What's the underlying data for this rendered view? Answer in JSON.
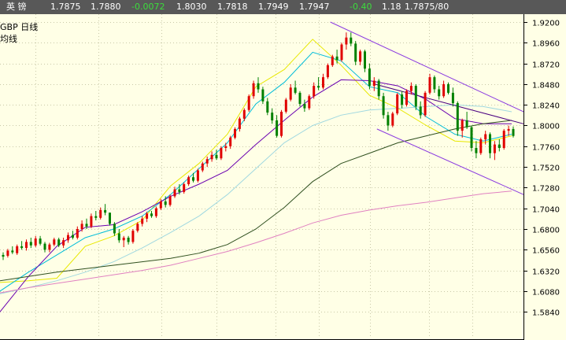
{
  "quote_bar": {
    "name": "英   镑",
    "last": "1.7875",
    "ask": "1.7880",
    "change": "-0.0072",
    "open": "1.8030",
    "low": "1.7818",
    "high": "1.7949",
    "close": "1.7947",
    "pct_change": "-0.40",
    "ratio": "1.18",
    "bid_ask": "1.7875/80"
  },
  "chart_labels": {
    "symbol_line1": "GBP  日线",
    "symbol_line2": "均线"
  },
  "colors": {
    "background": "#ffffe6",
    "up_candle": "#e00000",
    "down_candle": "#008000",
    "ma_fast": "#e8e800",
    "ma_cyan": "#00bcd8",
    "ma_purple": "#6a00b0",
    "ma_lightblue": "#a0d8e0",
    "ma_darkgreen": "#305020",
    "ma_pink": "#e080c0",
    "channel": "#8a3ae0",
    "axis_panel": "#ffffe6"
  },
  "chart_data": {
    "type": "candlestick",
    "title": "",
    "ylim": [
      1.57,
      1.935
    ],
    "y_ticks": [
      "1.9200",
      "1.8960",
      "1.8720",
      "1.8480",
      "1.8240",
      "1.8000",
      "1.7760",
      "1.7520",
      "1.7280",
      "1.7040",
      "1.6800",
      "1.6560",
      "1.6320",
      "1.6080",
      "1.5840"
    ],
    "grid": true,
    "candles": [
      [
        1.65,
        1.653,
        1.644,
        1.648
      ],
      [
        1.649,
        1.657,
        1.647,
        1.655
      ],
      [
        1.655,
        1.66,
        1.651,
        1.653
      ],
      [
        1.652,
        1.662,
        1.65,
        1.66
      ],
      [
        1.66,
        1.666,
        1.656,
        1.658
      ],
      [
        1.658,
        1.668,
        1.655,
        1.665
      ],
      [
        1.665,
        1.67,
        1.658,
        1.661
      ],
      [
        1.661,
        1.672,
        1.659,
        1.669
      ],
      [
        1.669,
        1.672,
        1.661,
        1.663
      ],
      [
        1.663,
        1.665,
        1.653,
        1.656
      ],
      [
        1.656,
        1.664,
        1.653,
        1.662
      ],
      [
        1.662,
        1.67,
        1.66,
        1.668
      ],
      [
        1.668,
        1.67,
        1.659,
        1.661
      ],
      [
        1.661,
        1.67,
        1.658,
        1.667
      ],
      [
        1.667,
        1.676,
        1.664,
        1.673
      ],
      [
        1.673,
        1.678,
        1.668,
        1.67
      ],
      [
        1.67,
        1.683,
        1.668,
        1.68
      ],
      [
        1.68,
        1.69,
        1.677,
        1.686
      ],
      [
        1.686,
        1.692,
        1.68,
        1.683
      ],
      [
        1.683,
        1.698,
        1.681,
        1.695
      ],
      [
        1.695,
        1.701,
        1.69,
        1.693
      ],
      [
        1.693,
        1.705,
        1.691,
        1.702
      ],
      [
        1.702,
        1.709,
        1.696,
        1.699
      ],
      [
        1.699,
        1.699,
        1.684,
        1.686
      ],
      [
        1.686,
        1.688,
        1.672,
        1.675
      ],
      [
        1.675,
        1.68,
        1.664,
        1.667
      ],
      [
        1.667,
        1.672,
        1.659,
        1.67
      ],
      [
        1.67,
        1.672,
        1.662,
        1.665
      ],
      [
        1.665,
        1.68,
        1.663,
        1.678
      ],
      [
        1.678,
        1.688,
        1.676,
        1.686
      ],
      [
        1.686,
        1.695,
        1.683,
        1.692
      ],
      [
        1.692,
        1.7,
        1.688,
        1.698
      ],
      [
        1.698,
        1.701,
        1.693,
        1.695
      ],
      [
        1.695,
        1.706,
        1.693,
        1.704
      ],
      [
        1.704,
        1.715,
        1.702,
        1.712
      ],
      [
        1.712,
        1.718,
        1.705,
        1.708
      ],
      [
        1.708,
        1.72,
        1.706,
        1.718
      ],
      [
        1.718,
        1.729,
        1.716,
        1.726
      ],
      [
        1.726,
        1.732,
        1.72,
        1.723
      ],
      [
        1.723,
        1.734,
        1.721,
        1.732
      ],
      [
        1.732,
        1.742,
        1.73,
        1.74
      ],
      [
        1.74,
        1.745,
        1.734,
        1.736
      ],
      [
        1.736,
        1.75,
        1.734,
        1.748
      ],
      [
        1.748,
        1.758,
        1.746,
        1.756
      ],
      [
        1.756,
        1.764,
        1.752,
        1.761
      ],
      [
        1.761,
        1.77,
        1.758,
        1.766
      ],
      [
        1.766,
        1.772,
        1.76,
        1.762
      ],
      [
        1.762,
        1.776,
        1.76,
        1.774
      ],
      [
        1.774,
        1.78,
        1.77,
        1.776
      ],
      [
        1.776,
        1.788,
        1.773,
        1.786
      ],
      [
        1.786,
        1.798,
        1.784,
        1.796
      ],
      [
        1.796,
        1.81,
        1.793,
        1.808
      ],
      [
        1.808,
        1.82,
        1.805,
        1.818
      ],
      [
        1.818,
        1.836,
        1.816,
        1.834
      ],
      [
        1.834,
        1.852,
        1.831,
        1.849
      ],
      [
        1.849,
        1.856,
        1.838,
        1.842
      ],
      [
        1.842,
        1.845,
        1.825,
        1.828
      ],
      [
        1.828,
        1.832,
        1.812,
        1.815
      ],
      [
        1.815,
        1.82,
        1.802,
        1.806
      ],
      [
        1.806,
        1.812,
        1.786,
        1.788
      ],
      [
        1.788,
        1.818,
        1.786,
        1.816
      ],
      [
        1.816,
        1.832,
        1.814,
        1.83
      ],
      [
        1.83,
        1.848,
        1.828,
        1.844
      ],
      [
        1.844,
        1.852,
        1.836,
        1.838
      ],
      [
        1.838,
        1.84,
        1.822,
        1.825
      ],
      [
        1.825,
        1.83,
        1.816,
        1.82
      ],
      [
        1.82,
        1.836,
        1.818,
        1.834
      ],
      [
        1.834,
        1.85,
        1.831,
        1.846
      ],
      [
        1.846,
        1.856,
        1.841,
        1.844
      ],
      [
        1.844,
        1.86,
        1.842,
        1.856
      ],
      [
        1.856,
        1.872,
        1.854,
        1.87
      ],
      [
        1.87,
        1.882,
        1.868,
        1.88
      ],
      [
        1.88,
        1.888,
        1.872,
        1.876
      ],
      [
        1.876,
        1.896,
        1.874,
        1.894
      ],
      [
        1.894,
        1.908,
        1.888,
        1.902
      ],
      [
        1.902,
        1.908,
        1.892,
        1.895
      ],
      [
        1.895,
        1.898,
        1.87,
        1.874
      ],
      [
        1.874,
        1.888,
        1.87,
        1.886
      ],
      [
        1.886,
        1.888,
        1.862,
        1.866
      ],
      [
        1.866,
        1.872,
        1.842,
        1.846
      ],
      [
        1.846,
        1.856,
        1.84,
        1.852
      ],
      [
        1.852,
        1.854,
        1.83,
        1.834
      ],
      [
        1.834,
        1.838,
        1.808,
        1.812
      ],
      [
        1.812,
        1.816,
        1.794,
        1.8
      ],
      [
        1.8,
        1.816,
        1.798,
        1.814
      ],
      [
        1.814,
        1.838,
        1.812,
        1.836
      ],
      [
        1.836,
        1.84,
        1.82,
        1.824
      ],
      [
        1.824,
        1.842,
        1.822,
        1.84
      ],
      [
        1.84,
        1.85,
        1.836,
        1.846
      ],
      [
        1.846,
        1.848,
        1.818,
        1.822
      ],
      [
        1.822,
        1.828,
        1.808,
        1.812
      ],
      [
        1.812,
        1.84,
        1.81,
        1.838
      ],
      [
        1.838,
        1.86,
        1.836,
        1.856
      ],
      [
        1.856,
        1.858,
        1.838,
        1.842
      ],
      [
        1.842,
        1.846,
        1.83,
        1.834
      ],
      [
        1.834,
        1.852,
        1.832,
        1.848
      ],
      [
        1.848,
        1.85,
        1.836,
        1.838
      ],
      [
        1.838,
        1.844,
        1.822,
        1.826
      ],
      [
        1.826,
        1.828,
        1.788,
        1.794
      ],
      [
        1.794,
        1.808,
        1.786,
        1.806
      ],
      [
        1.806,
        1.816,
        1.796,
        1.798
      ],
      [
        1.798,
        1.8,
        1.77,
        1.774
      ],
      [
        1.774,
        1.782,
        1.762,
        1.768
      ],
      [
        1.768,
        1.786,
        1.766,
        1.784
      ],
      [
        1.784,
        1.794,
        1.778,
        1.79
      ],
      [
        1.79,
        1.792,
        1.762,
        1.768
      ],
      [
        1.768,
        1.782,
        1.76,
        1.778
      ],
      [
        1.778,
        1.784,
        1.77,
        1.774
      ],
      [
        1.774,
        1.796,
        1.772,
        1.794
      ],
      [
        1.794,
        1.8,
        1.788,
        1.796
      ],
      [
        1.796,
        1.799,
        1.786,
        1.788
      ]
    ],
    "moving_averages": [
      {
        "color": "#e8e800",
        "points": [
          1.618,
          1.62,
          1.623,
          1.66,
          1.672,
          1.69,
          1.73,
          1.756,
          1.79,
          1.845,
          1.865,
          1.9,
          1.87,
          1.835,
          1.82,
          1.8,
          1.782,
          1.78,
          1.788
        ]
      },
      {
        "color": "#00bcd8",
        "points": [
          1.608,
          1.63,
          1.65,
          1.67,
          1.68,
          1.695,
          1.72,
          1.75,
          1.78,
          1.825,
          1.85,
          1.885,
          1.875,
          1.845,
          1.838,
          1.81,
          1.79,
          1.782,
          1.79
        ]
      },
      {
        "color": "#6a00b0",
        "points": [
          1.584,
          1.625,
          1.66,
          1.682,
          1.685,
          1.7,
          1.718,
          1.732,
          1.748,
          1.778,
          1.806,
          1.833,
          1.853,
          1.852,
          1.846,
          1.83,
          1.808,
          1.802,
          1.802
        ]
      },
      {
        "color": "#a0d8e0",
        "points": [
          1.605,
          1.612,
          1.62,
          1.63,
          1.642,
          1.658,
          1.676,
          1.695,
          1.72,
          1.75,
          1.78,
          1.8,
          1.812,
          1.818,
          1.82,
          1.822,
          1.824,
          1.822,
          1.816
        ]
      },
      {
        "color": "#305020",
        "points": [
          1.62,
          1.625,
          1.63,
          1.634,
          1.638,
          1.642,
          1.646,
          1.652,
          1.662,
          1.68,
          1.705,
          1.735,
          1.756,
          1.768,
          1.78,
          1.788,
          1.796,
          1.802,
          1.806
        ]
      },
      {
        "color": "#e080c0",
        "points": [
          1.606,
          1.612,
          1.617,
          1.622,
          1.627,
          1.632,
          1.638,
          1.646,
          1.654,
          1.664,
          1.675,
          1.687,
          1.696,
          1.702,
          1.707,
          1.711,
          1.716,
          1.721,
          1.724
        ]
      }
    ],
    "channel": {
      "upper": [
        [
          0.631,
          1.92
        ],
        [
          1.0,
          1.816
        ]
      ],
      "lower": [
        [
          0.72,
          1.796
        ],
        [
          1.0,
          1.72
        ]
      ],
      "mid": [
        [
          0.716,
          1.848
        ],
        [
          1.0,
          1.802
        ]
      ]
    }
  }
}
